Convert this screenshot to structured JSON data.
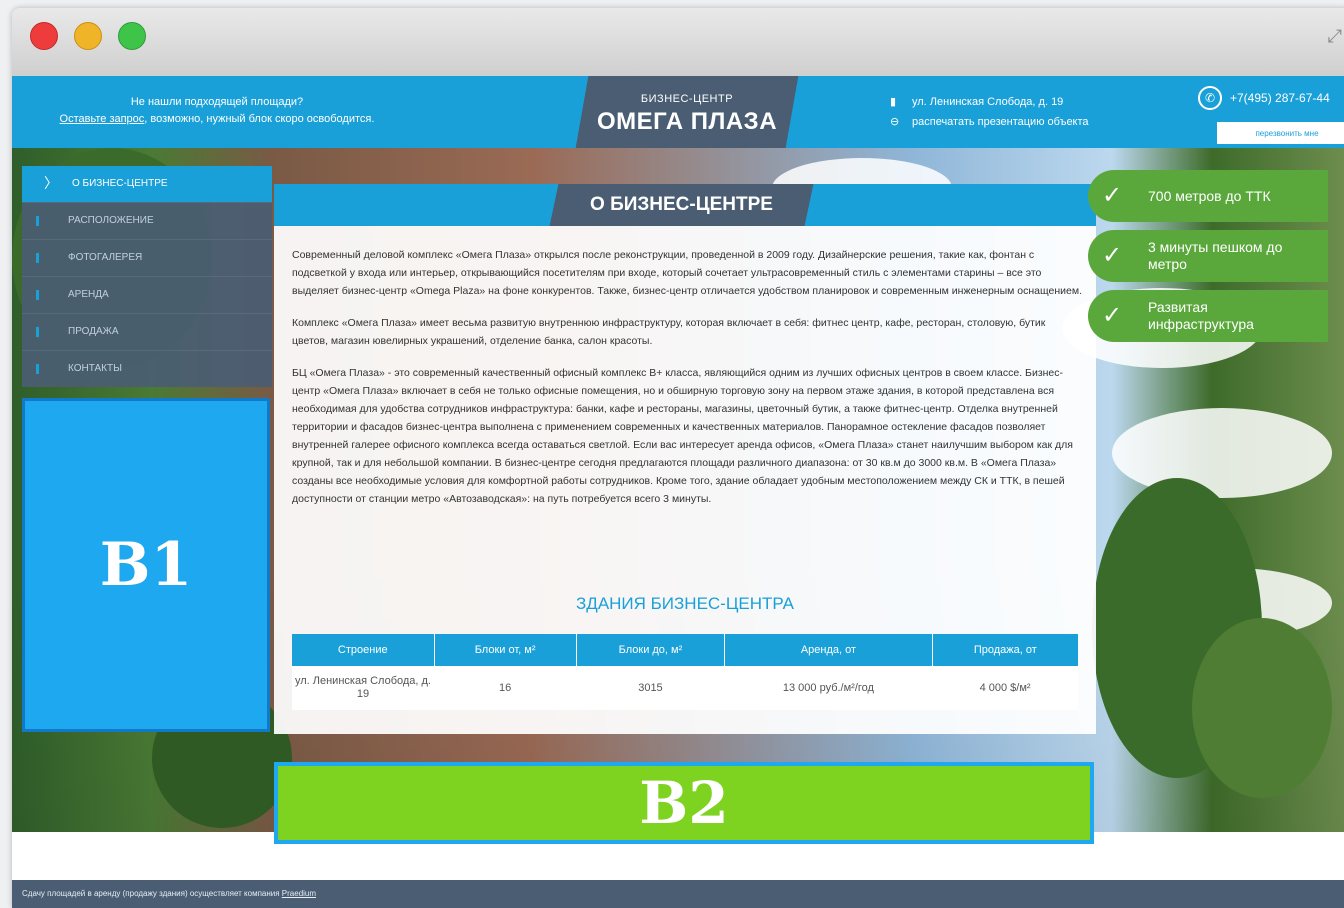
{
  "window": {
    "buttons": [
      "close",
      "minimize",
      "zoom"
    ],
    "expand_icon": "expand-icon"
  },
  "header": {
    "notice_line1": "Не нашли подходящей площади?",
    "notice_link": "Оставьте запрос",
    "notice_rest": ", возможно, нужный блок скоро освободится.",
    "logo_sub": "БИЗНЕС-ЦЕНТР",
    "logo_main": "ОМЕГА ПЛАЗА",
    "address": "ул. Ленинская Слобода, д. 19",
    "print_link": "распечатать презентацию объекта",
    "phone": "+7(495) 287-67-44",
    "callback_button": "перезвонить мне"
  },
  "menu": {
    "active": "О БИЗНЕС-ЦЕНТРЕ",
    "items": [
      "РАСПОЛОЖЕНИЕ",
      "ФОТОГАЛЕРЕЯ",
      "АРЕНДА",
      "ПРОДАЖА",
      "КОНТАКТЫ"
    ]
  },
  "placeholders": {
    "b1": "B1",
    "b2": "B2"
  },
  "content": {
    "title": "О БИЗНЕС-ЦЕНТРЕ",
    "paragraphs": [
      "Современный деловой комплекс «Омега Плаза» открылся после реконструкции, проведенной в 2009 году. Дизайнерские решения, такие как, фонтан с подсветкой у входа или интерьер, открывающийся посетителям при входе, который сочетает ультрасовременный стиль с элементами старины – все это выделяет бизнес-центр «Omega Plaza» на фоне конкурентов. Также, бизнес-центр отличается удобством планировок и современным инженерным оснащением.",
      "Комплекс «Омега Плаза» имеет весьма развитую внутреннюю инфраструктуру, которая включает в себя: фитнес центр, кафе, ресторан, столовую, бутик цветов, магазин ювелирных украшений, отделение банка, салон красоты.",
      "БЦ «Омега Плаза» - это современный качественный офисный комплекс B+ класса, являющийся одним из лучших офисных центров в своем классе. Бизнес-центр «Омега Плаза» включает в себя не только офисные помещения, но и обширную торговую зону на первом этаже здания, в которой представлена вся необходимая для удобства сотрудников инфраструктура: банки, кафе и рестораны, магазины, цветочный бутик, а также фитнес-центр. Отделка внутренней территории и фасадов бизнес-центра выполнена с применением современных и качественных материалов. Панорамное остекление фасадов позволяет внутренней галерее офисного комплекса всегда оставаться светлой. Если вас интересует аренда офисов, «Омега Плаза» станет наилучшим выбором как для крупной, так и для небольшой компании. В бизнес-центре сегодня предлагаются площади различного диапазона: от 30 кв.м до 3000 кв.м. В «Омега Плаза» созданы все необходимые условия для комфортной работы сотрудников. Кроме того, здание обладает удобным местоположением между СК и ТТК, в пешей доступности от станции метро «Автозаводская»: на путь потребуется всего 3 минуты."
    ],
    "buildings_title": "ЗДАНИЯ БИЗНЕС-ЦЕНТРА",
    "table": {
      "headers": [
        "Строение",
        "Блоки от, м²",
        "Блоки до, м²",
        "Аренда, от",
        "Продажа, от"
      ],
      "rows": [
        [
          "ул. Ленинская Слобода, д. 19",
          "16",
          "3015",
          "13 000 руб./м²/год",
          "4 000 $/м²"
        ]
      ]
    }
  },
  "bullets": [
    "700 метров до ТТК",
    "3 минуты пешком до метро",
    "Развитая инфраструктура"
  ],
  "footer": {
    "text": "Сдачу площадей в аренду (продажу здания) осуществляет компания ",
    "link": "Praedium"
  },
  "colors": {
    "accent_blue": "#1aa0d8",
    "dark_slate": "#4a5d73",
    "green": "#5aa83b",
    "b1_fill": "#1ea8ef",
    "b2_fill": "#7ed321"
  }
}
